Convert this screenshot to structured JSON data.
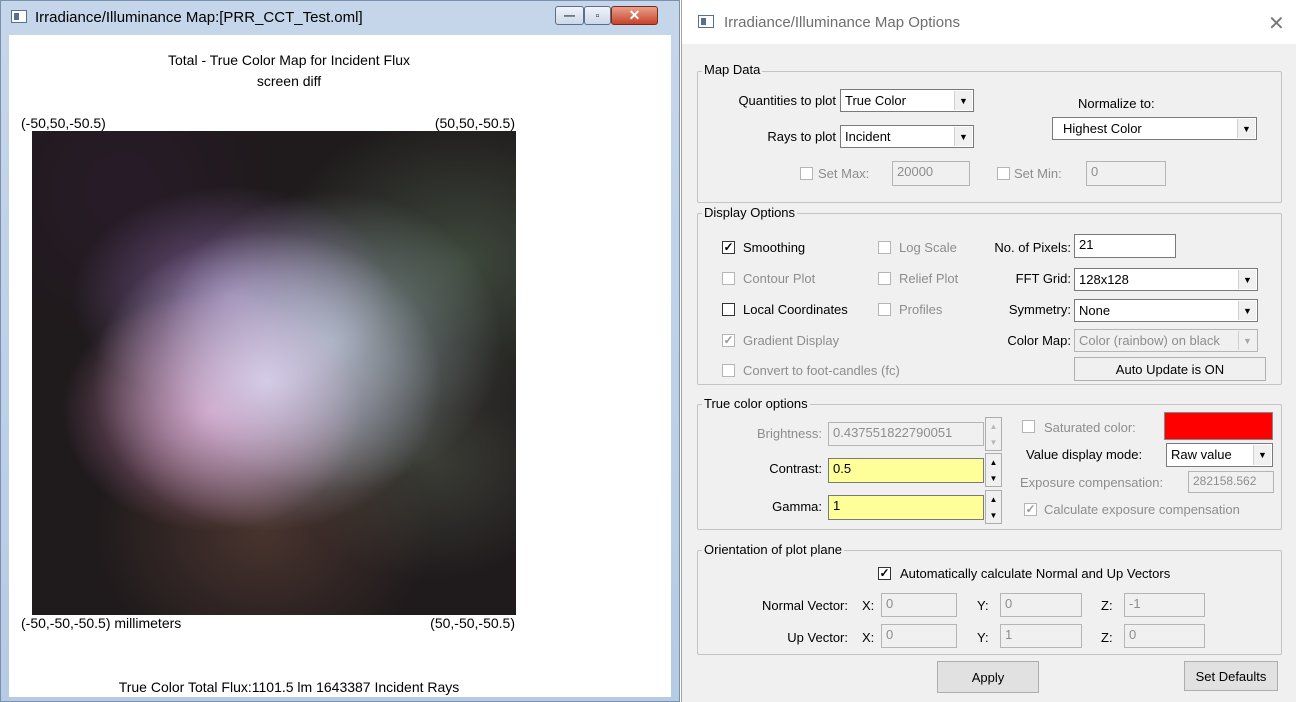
{
  "map_window": {
    "title": "Irradiance/Illuminance Map:[PRR_CCT_Test.oml]",
    "minimize": "—",
    "maximize": "▫",
    "close": "✕",
    "plot_title": "Total - True Color Map for Incident Flux",
    "plot_subtitle": "screen diff",
    "corner_top_left": "(-50,50,-50.5)",
    "corner_top_right": "(50,50,-50.5)",
    "corner_bottom_left": "(-50,-50,-50.5) millimeters",
    "corner_bottom_right": "(50,-50,-50.5)",
    "footer": "True Color Total Flux:1101.5 lm 1643387 Incident Rays"
  },
  "dialog": {
    "title": "Irradiance/Illuminance Map Options",
    "close": "✕",
    "map_data": {
      "legend": "Map Data",
      "quantities_label": "Quantities to plot",
      "quantities_value": "True Color",
      "rays_label": "Rays to plot",
      "rays_value": "Incident",
      "normalize_label": "Normalize to:",
      "normalize_value": "Highest Color",
      "set_max_label": "Set Max:",
      "set_max_value": "20000",
      "set_min_label": "Set Min:",
      "set_min_value": "0"
    },
    "display_options": {
      "legend": "Display Options",
      "smoothing": "Smoothing",
      "log_scale": "Log Scale",
      "pixels_label": "No. of Pixels:",
      "pixels_value": "21",
      "contour_plot": "Contour Plot",
      "relief_plot": "Relief Plot",
      "fft_label": "FFT Grid:",
      "fft_value": "128x128",
      "local_coordinates": "Local Coordinates",
      "profiles": "Profiles",
      "symmetry_label": "Symmetry:",
      "symmetry_value": "None",
      "gradient_display": "Gradient Display",
      "colormap_label": "Color Map:",
      "colormap_value": "Color (rainbow) on black",
      "foot_candles": "Convert to foot-candles (fc)",
      "auto_update": "Auto Update is ON"
    },
    "true_color": {
      "legend": "True color options",
      "brightness_label": "Brightness:",
      "brightness_value": "0.437551822790051",
      "saturated_label": "Saturated color:",
      "saturated_color": "#ff0000",
      "value_mode_label": "Value display mode:",
      "value_mode_value": "Raw value",
      "contrast_label": "Contrast:",
      "contrast_value": "0.5",
      "exposure_label": "Exposure compensation:",
      "exposure_value": "282158.562",
      "gamma_label": "Gamma:",
      "gamma_value": "1",
      "calc_exposure": "Calculate exposure compensation"
    },
    "orientation": {
      "legend": "Orientation of plot plane",
      "auto_calc": "Automatically calculate Normal and Up Vectors",
      "normal_label": "Normal Vector:",
      "up_label": "Up Vector:",
      "x_label": "X:",
      "y_label": "Y:",
      "z_label": "Z:",
      "normal_x": "0",
      "normal_y": "0",
      "normal_z": "-1",
      "up_x": "0",
      "up_y": "1",
      "up_z": "0"
    },
    "apply": "Apply",
    "set_defaults": "Set Defaults",
    "check_mark": "✓",
    "arrow_down": "▼",
    "arrow_up": "▲"
  }
}
